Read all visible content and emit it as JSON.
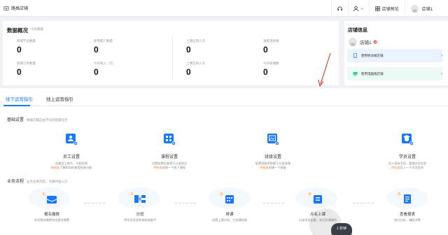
{
  "header": {
    "brand": "路格店铺",
    "store_preview": "店铺预览",
    "user_name": "店铺1"
  },
  "overview": {
    "title": "数据概况",
    "subtitle": "今日数据",
    "stats": [
      {
        "label": "新增学员数量",
        "value": "0"
      },
      {
        "label": "新增客户数量",
        "value": "0"
      },
      {
        "label": "上课应到人次",
        "value": "0"
      },
      {
        "label": "请假消耗数",
        "value": "0"
      },
      {
        "label": "新增订单数量",
        "value": "0"
      },
      {
        "label": "今日收入（元）",
        "value": "0"
      },
      {
        "label": "上课实到人次",
        "value": "0"
      },
      {
        "label": "今日排课数",
        "value": "0"
      }
    ]
  },
  "store": {
    "title": "店铺信息",
    "name": "店铺1",
    "mobile_link": "使用移动端店铺",
    "pc_link": "使用电脑端店铺",
    "arrow": "›"
  },
  "guide": {
    "tabs": [
      "线下运营指引",
      "线上运营指引"
    ],
    "basic": {
      "title": "基础设置",
      "hint": "根据店铺自由学员的配置任务"
    },
    "settings": [
      {
        "name": "员工设置",
        "desc": "创建员工账号，分配权限",
        "tip_link": "体检成",
        "tip_rest": "了解帮您的使用权限分配"
      },
      {
        "name": "课程设置",
        "desc": "设置收费标准便于分班购买",
        "tip_link": "传检成",
        "tip_rest": "创建一个线下课程"
      },
      {
        "name": "班级设置",
        "desc": "配置班级名称便于分班排课",
        "tip_link": "传检成",
        "tip_rest": "创建一个班级"
      },
      {
        "name": "学员设置",
        "desc": "导入现有学员，管理学员信息",
        "tip_link": "传检成",
        "tip_rest": "导入一个学员信息"
      }
    ],
    "flow": {
      "title": "业务流程",
      "hint": "业务主要流程，可随时插入口"
    },
    "steps": [
      {
        "num": "1",
        "name": "报名缴费",
        "desc": "学员报名缴费完成报名缴费"
      },
      {
        "num": "2",
        "name": "分班",
        "desc": "将学员添加到具体班级中"
      },
      {
        "num": "3",
        "name": "排课",
        "desc": "设置上课计划，生成课程表"
      },
      {
        "num": "4",
        "name": "点名上课",
        "desc": "记录学员出勤，执行扣课操作"
      },
      {
        "num": "5",
        "name": "查看报表",
        "desc": "统计分析，辅助决策"
      }
    ]
  },
  "float_widget": {
    "label": "1 秒钟"
  },
  "colors": {
    "primary": "#1677ff",
    "accent": "#ff7a29",
    "annotation": "#e0201b"
  }
}
